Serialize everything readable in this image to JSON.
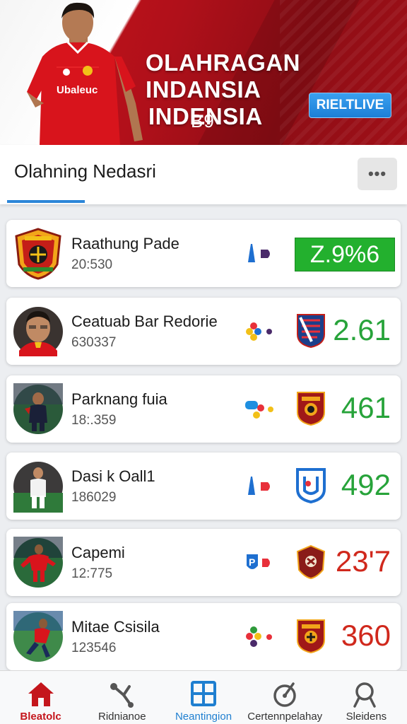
{
  "hero": {
    "title_line1": "OLAHRAGAN INDANSIA",
    "title_line2": "INDENSIA",
    "subtitle": "B9",
    "badge": "RIELTLIVE",
    "jersey_text": "Ubaleuc"
  },
  "section": {
    "title": "Olahning Nedasri",
    "more_label": "•••"
  },
  "items": [
    {
      "name": "Raathung Pade",
      "sub": "20:530",
      "score": "Z.9%6",
      "score_color": "#ffffff",
      "highlight": true
    },
    {
      "name": "Ceatuab Bar Redorie",
      "sub": "630337",
      "score": "2.61",
      "score_color": "#27a33a"
    },
    {
      "name": "Parknang fuia",
      "sub": "18:.359",
      "score": "461",
      "score_color": "#27a33a"
    },
    {
      "name": "Dasi k Oall1",
      "sub": "186029",
      "score": "492",
      "score_color": "#27a33a"
    },
    {
      "name": "Capemi",
      "sub": "12:775",
      "score": "23'7",
      "score_color": "#d0281c"
    },
    {
      "name": "Mitae Csisila",
      "sub": "123546",
      "score": "360",
      "score_color": "#d0281c"
    }
  ],
  "nav": [
    {
      "label": "Bleatolc",
      "icon": "home-icon"
    },
    {
      "label": "Ridnianoe",
      "icon": "share-icon"
    },
    {
      "label": "Neantingion",
      "icon": "grid-icon"
    },
    {
      "label": "Certennpelahay",
      "icon": "ball-icon"
    },
    {
      "label": "Sleidens",
      "icon": "search-icon"
    }
  ],
  "colors": {
    "brand_red": "#c4161c",
    "accent_blue": "#2c86d8",
    "positive_green": "#27a33a",
    "negative_red": "#d0281c",
    "badge_green": "#23b02e"
  }
}
